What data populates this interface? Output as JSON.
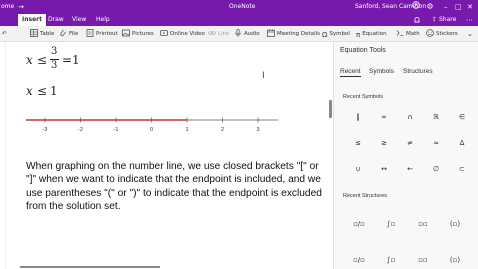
{
  "titlebar": {
    "left_text": "ome",
    "back_glyph": "→",
    "app_title": "OneNote",
    "user": "Sanford, Sean Cameron",
    "window_min": "–",
    "window_max": "□",
    "window_close": "✕"
  },
  "menubar": {
    "tabs": [
      "Insert",
      "Draw",
      "View",
      "Help"
    ],
    "share_label": "Share",
    "more_glyph": "⋯"
  },
  "ribbon": {
    "items": [
      {
        "label": "Table",
        "icon": "table-icon",
        "disabled": false
      },
      {
        "label": "File",
        "icon": "file-icon",
        "disabled": false
      },
      {
        "label": "Printout",
        "icon": "printout-icon",
        "disabled": false
      },
      {
        "label": "Pictures",
        "icon": "pictures-icon",
        "disabled": false
      },
      {
        "label": "Online Video",
        "icon": "online-video-icon",
        "disabled": false
      },
      {
        "label": "Link",
        "icon": "link-icon",
        "disabled": true
      },
      {
        "label": "Audio",
        "icon": "audio-icon",
        "disabled": false
      },
      {
        "label": "Meeting Details",
        "icon": "meeting-details-icon",
        "disabled": false
      },
      {
        "label": "Symbol",
        "icon": "symbol-icon",
        "disabled": false
      },
      {
        "label": "Equation",
        "icon": "equation-icon",
        "disabled": false
      },
      {
        "label": "Math",
        "icon": "math-icon",
        "disabled": false
      },
      {
        "label": "Stickers",
        "icon": "stickers-icon",
        "disabled": false
      }
    ]
  },
  "page": {
    "eq1": {
      "var": "x",
      "op": "≤",
      "num": "3",
      "den": "3",
      "eq": "=",
      "rhs": "1"
    },
    "eq2": {
      "var": "x",
      "op": "≤",
      "rhs": "1"
    },
    "number_line": {
      "ticks": [
        "-3",
        "-2",
        "-1",
        "0",
        "1",
        "2",
        "3"
      ],
      "ray_color": "#c0392b",
      "endpoint": "1",
      "direction": "left"
    },
    "paragraph": "When graphing on the number line, we use closed brackets \"[\" or \"]\" when we want to indicate that the endpoint is included, and we use parentheses \"(\" or \")\" to indicate that the endpoint is excluded from the solution set."
  },
  "pane": {
    "title": "Equation Tools",
    "tabs": [
      "Recent",
      "Symbols",
      "Structures"
    ],
    "recent_symbols_title": "Recent Symbols",
    "recent_symbols": [
      "‖",
      "∞",
      "∩",
      "ℝ",
      "∈",
      "≤",
      "≥",
      "≠",
      "≈",
      "Δ",
      "∪",
      "↔",
      "←",
      "∅",
      "⊂"
    ],
    "recent_structures_title": "Recent Structures",
    "recent_structures": [
      "▫/▫",
      "∫▫",
      "▫▫",
      "(▫)",
      "▫/▫",
      "∫▫",
      "▫▫",
      "(▫)"
    ]
  },
  "colors": {
    "accent": "#7719aa",
    "ray": "#c0392b"
  }
}
